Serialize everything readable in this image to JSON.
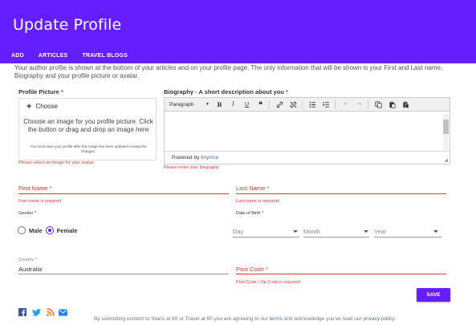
{
  "header": {
    "title": "Update Profile",
    "nav": [
      "ADD",
      "ARTICLES",
      "TRAVEL BLOGS"
    ]
  },
  "intro": "Your author profile is shown at the bottom of your articles and on your profile page. The only information that will be shown is your First and Last name, Biography and your profile picture or avatar.",
  "picture": {
    "label": "Profile Picture",
    "required_mark": "*",
    "choose": "Choose",
    "instructions": "Choose an image for you profile picture. Click the button or drag and drop an image here",
    "note": "You must save your profile after the image has been updated to keep the changes.",
    "error": "Please select an image for your avatar"
  },
  "biography": {
    "label": "Biography - A short description about you",
    "required_mark": "*",
    "format_select": "Paragraph",
    "powered_by": "Powered by",
    "powered_link": "tinymce",
    "error": "Please enter your biography"
  },
  "first_name": {
    "label": "First Name *",
    "error": "First name is required"
  },
  "last_name": {
    "label": "Last Name *",
    "error": "Last name is required"
  },
  "gender": {
    "label": "Gender *",
    "options": [
      "Male",
      "Female"
    ],
    "selected": "Female"
  },
  "dob": {
    "label": "Date of Birth *",
    "day": "Day",
    "month": "Month",
    "year": "Year"
  },
  "country": {
    "label": "Country *",
    "value": "Australia"
  },
  "post_code": {
    "label": "Post Code *",
    "error": "Post Code / Zip Code is required"
  },
  "save_label": "SAVE",
  "footer": {
    "text_before": "By submitting content to Starts at 60 or Travel at 60 you are agreeing to our",
    "terms": "terms",
    "text_middle": "and acknowledge you've read our",
    "privacy": "privacy policy",
    "text_end": "."
  },
  "social_icons": [
    "facebook-icon",
    "twitter-icon",
    "rss-icon",
    "email-icon"
  ],
  "colors": {
    "primary": "#651fff",
    "error": "#e53935",
    "link": "#4a6cb3"
  }
}
